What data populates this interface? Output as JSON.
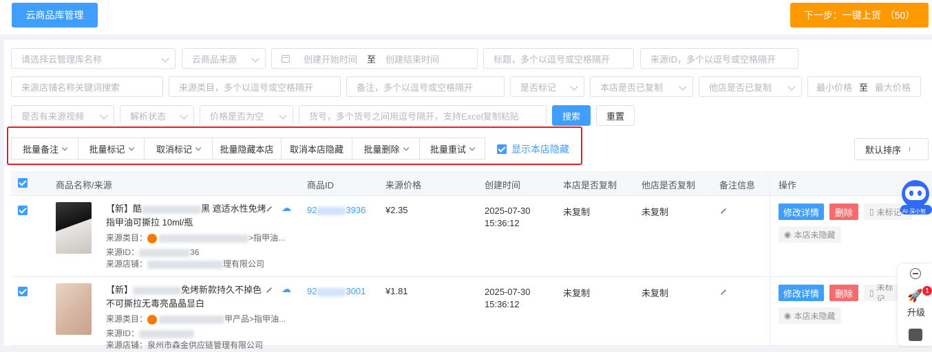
{
  "header": {
    "manage_button": "云商品库管理",
    "next_button": "下一步：一键上货",
    "next_count": "（50）"
  },
  "filters": {
    "cloud_lib": "请选择云管理库名称",
    "cloud_source": "云商品来源",
    "create_start": "创建开始时间",
    "range_sep": "至",
    "create_end": "创建结束时间",
    "title_ph": "标题，多个以逗号或空格隔开",
    "source_id_ph": "来源ID，多个以逗号或空格隔开",
    "shop_keyword": "来源店铺名称关键词搜索",
    "source_category": "来源类目，多个以逗号或空格隔开",
    "remark_ph": "备注，多个以逗号或空格隔开",
    "marked": "是否标记",
    "this_copied": "本店是否已复制",
    "other_copied": "他店是否已复制",
    "min_price": "最小价格",
    "price_sep": "至",
    "max_price": "最大价格",
    "has_video": "是否有来源视频",
    "parse_status": "解析状态",
    "price_empty": "价格是否为空",
    "sku_ph": "货号，多个货号之间用逗号隔开，支持Excel复制粘贴",
    "search_button": "搜索",
    "reset_button": "重置"
  },
  "batch": {
    "remark": "批量备注",
    "mark": "批量标记",
    "unmark": "取消标记",
    "hide_store": "批量隐藏本店",
    "unhide_store": "取消本店隐藏",
    "delete": "批量删除",
    "retry": "批量重试",
    "show_hidden": "显示本店隐藏",
    "sort": "默认排序"
  },
  "table": {
    "headers": {
      "name": "商品名称/来源",
      "id": "商品ID",
      "price": "来源价格",
      "created": "创建时间",
      "this_copied": "本店是否复制",
      "other_copied": "他店是否复制",
      "remark": "备注信息",
      "ops": "操作"
    },
    "rows": [
      {
        "title_a": "【新】酷",
        "title_b": "黑 遮适水性免烤",
        "title_c": "指甲油可撕拉 10ml/瓶",
        "cat_label": "来源类目：",
        "cat_tail": ">指甲油...",
        "id_label": "来源ID：",
        "id_tail": "36",
        "shop_label": "来源店铺：",
        "shop_tail": "理有限公司",
        "id_a": "92",
        "id_b": "3936",
        "price": "¥2.35",
        "date": "2025-07-30",
        "time": "15:36:12",
        "this_copied": "未复制",
        "other_copied": "未复制",
        "edit": "修改详情",
        "delete": "删除",
        "unmark": "未标记",
        "hide": "本店未隐藏"
      },
      {
        "title_a": "【新】",
        "title_b": "免烤新款持久不掉色",
        "title_c": "不可撕拉无毒亮晶晶显白",
        "cat_label": "来源类目：",
        "cat_tail": "甲产品>指甲油...",
        "id_label": "来源ID：",
        "id_tail": "",
        "shop_label": "来源店铺：",
        "shop_tail": "泉州市森金供应链管理有限公司",
        "id_a": "92",
        "id_b": "3001",
        "price": "¥1.81",
        "date": "2025-07-30",
        "time": "15:36:12",
        "this_copied": "未复制",
        "other_copied": "未复制",
        "edit": "修改详情",
        "delete": "删除",
        "unmark": "未标记",
        "hide": "本店未隐藏"
      }
    ]
  },
  "side": {
    "ai_label": "AI·深小智",
    "upgrade": "升级",
    "badge": "1"
  },
  "colors": {
    "primary": "#409eff",
    "orange": "#ff9900",
    "danger": "#f56c6c",
    "highlight_box": "#e02020"
  }
}
